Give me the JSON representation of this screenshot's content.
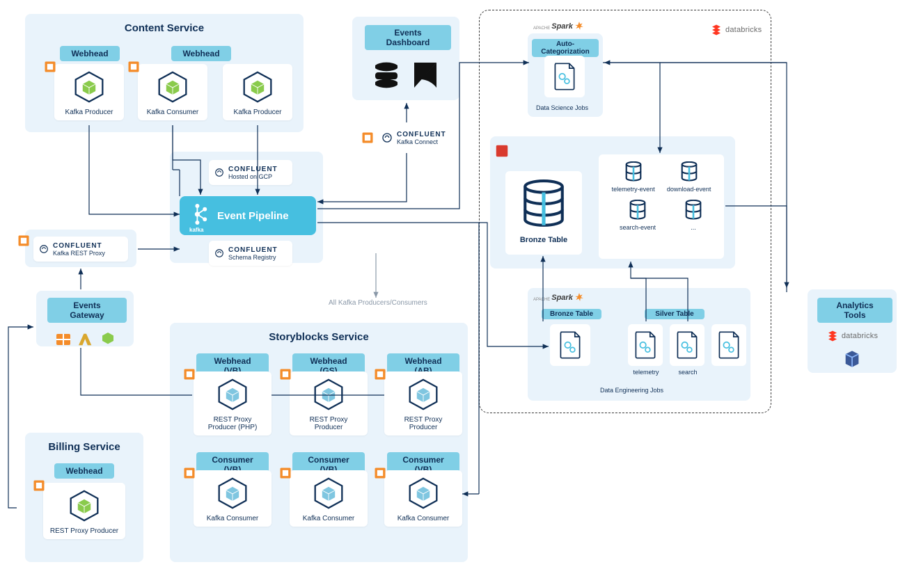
{
  "contentService": {
    "title": "Content Service",
    "webheadA": "Webhead",
    "webheadB": "Webhead",
    "producerA": "Kafka Producer",
    "consumer": "Kafka Consumer",
    "producerB": "Kafka Producer"
  },
  "eventsDashboard": {
    "title": "Events Dashboard"
  },
  "confluent": {
    "brand": "CONFLUENT",
    "kafkaConnect": "Kafka Connect",
    "hostedOnGcp": "Hosted on GCP",
    "restProxy": "Kafka REST Proxy",
    "schemaRegistry": "Schema Registry"
  },
  "eventPipeline": {
    "label": "Event Pipeline",
    "kafkaWord": "kafka"
  },
  "eventsGateway": {
    "title": "Events Gateway"
  },
  "noteAllProducers": "All Kafka Producers/Consumers",
  "billingService": {
    "title": "Billing Service",
    "webhead": "Webhead",
    "producer": "REST Proxy Producer"
  },
  "storyblocks": {
    "title": "Storyblocks Service",
    "webheadVB": "Webhead (VB)",
    "webheadGS": "Webhead (GS)",
    "webheadAB": "Webhead (AB)",
    "producerPHP": "REST Proxy\nProducer (PHP)",
    "producer": "REST Proxy\nProducer",
    "consumerVB": "Consumer (VB)",
    "kafkaConsumer": "Kafka Consumer"
  },
  "databricks": {
    "brand": "databricks",
    "autoCat": "Auto-Categorization",
    "dsJobs": "Data Science Jobs",
    "bronzeTable": "Bronze Table",
    "telemetryEvent": "telemetry-event",
    "downloadEvent": "download-event",
    "searchEvent": "search-event",
    "dots": "...",
    "bronzePill": "Bronze Table",
    "silverPill": "Silver Table",
    "telemetry": "telemetry",
    "search": "search",
    "deJobs": "Data Engineering Jobs"
  },
  "analytics": {
    "title": "Analytics Tools"
  },
  "spark": {
    "brand": "Spark",
    "apache": "APACHE"
  },
  "colors": {
    "panelBg": "#e9f3fb",
    "pill": "#80cfe6",
    "pipeline": "#46bfe0",
    "navy": "#0f2f56",
    "green": "#8acb4c",
    "blue": "#7fc6e0",
    "orange": "#f48c2a",
    "red": "#d93a2e"
  }
}
